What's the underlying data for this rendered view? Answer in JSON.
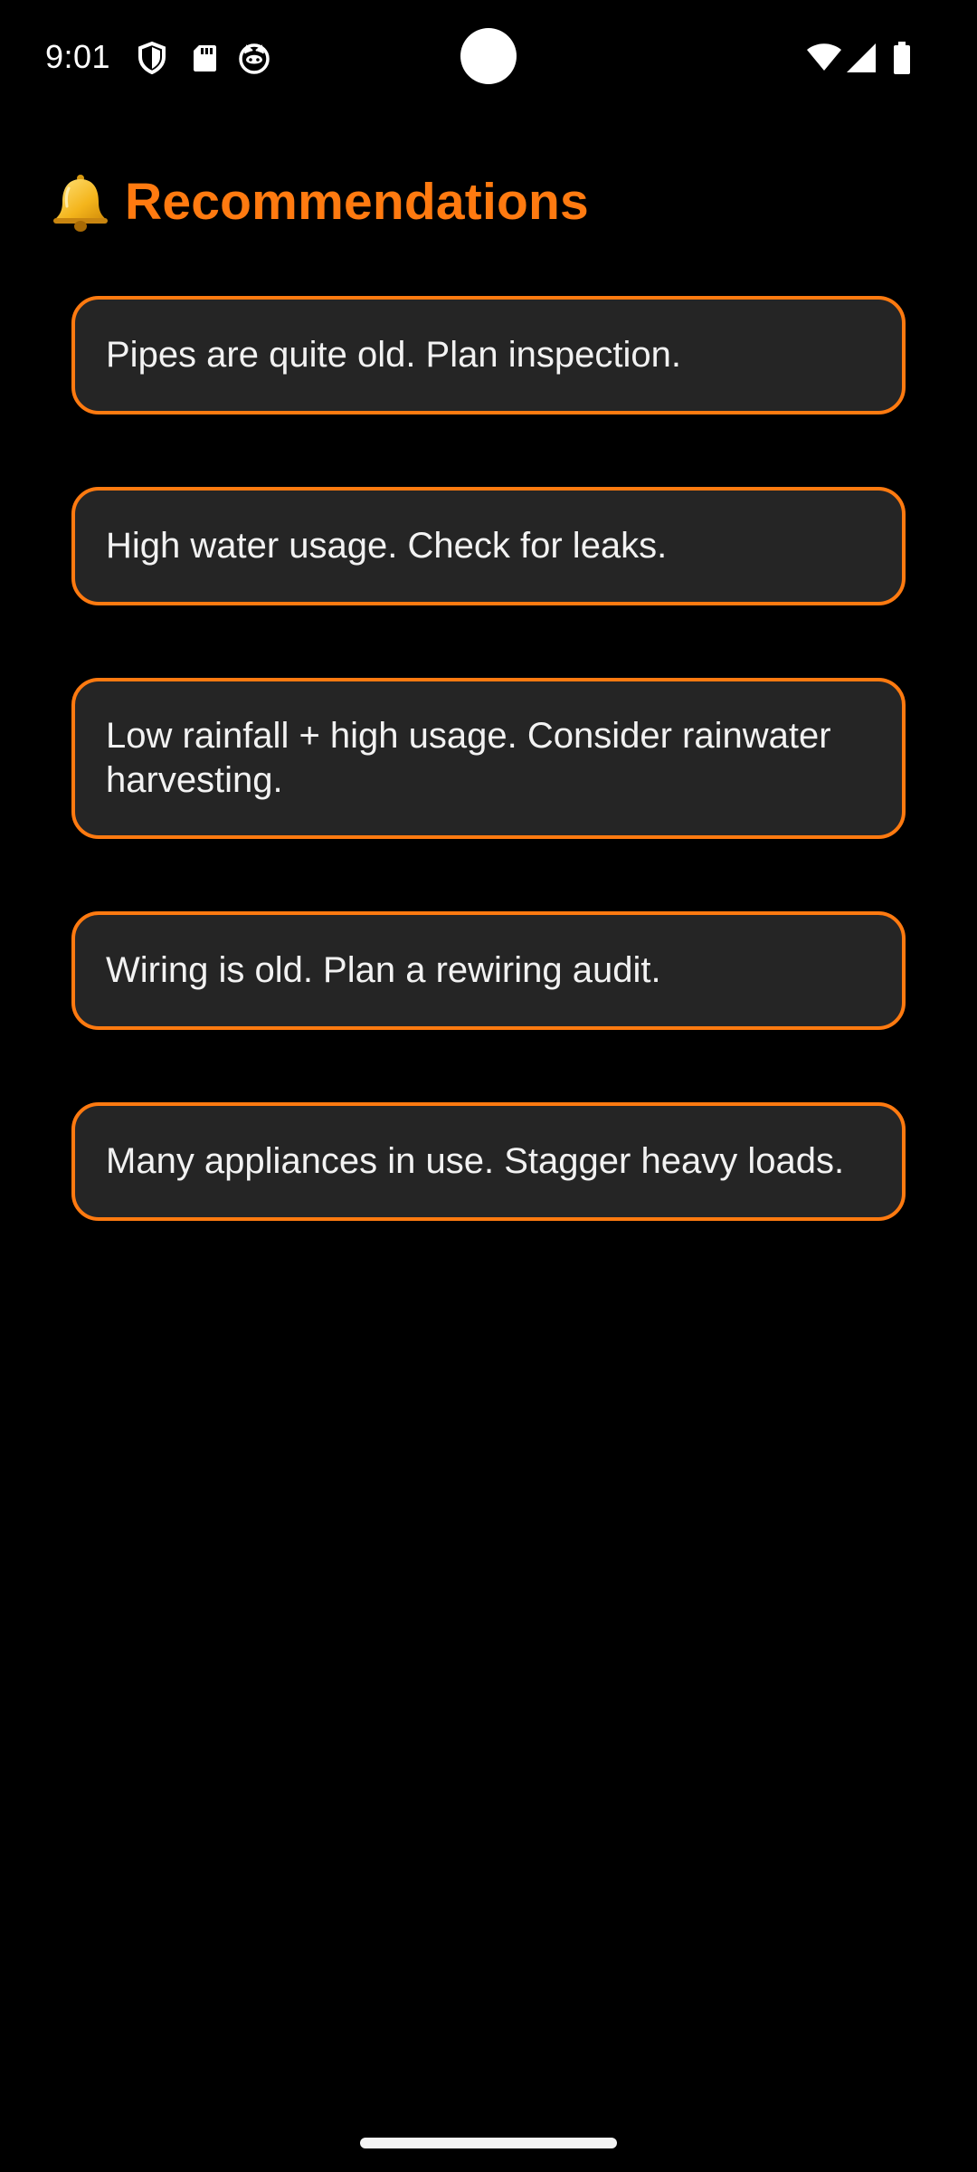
{
  "status_bar": {
    "time": "9:01",
    "left_icons": [
      "shield-icon",
      "sd-card-icon",
      "cat-face-icon"
    ],
    "right_icons": [
      "wifi-icon",
      "cellular-signal-icon",
      "battery-icon"
    ]
  },
  "header": {
    "icon": "bell-icon",
    "title": "Recommendations"
  },
  "recommendations": [
    "Pipes are quite old. Plan inspection.",
    "High water usage. Check for leaks.",
    "Low rainfall + high usage. Consider rainwater harvesting.",
    "Wiring is old. Plan a rewiring audit.",
    "Many appliances in use. Stagger heavy loads."
  ],
  "colors": {
    "accent": "#ff7a10",
    "background": "#000000",
    "card": "#252525",
    "text": "#f2f2f2"
  }
}
